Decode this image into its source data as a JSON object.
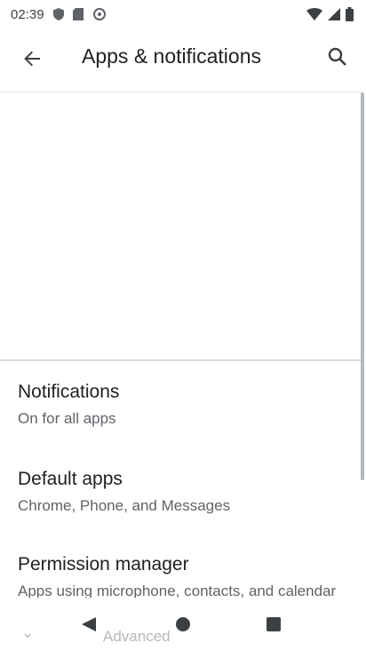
{
  "status_bar": {
    "time": "02:39"
  },
  "app_bar": {
    "title": "Apps & notifications"
  },
  "list": [
    {
      "title": "Notifications",
      "subtitle": "On for all apps"
    },
    {
      "title": "Default apps",
      "subtitle": "Chrome, Phone, and Messages"
    },
    {
      "title": "Permission manager",
      "subtitle": "Apps using microphone, contacts, and calendar"
    }
  ],
  "advanced": {
    "label": "Advanced"
  },
  "icons": {
    "back": "arrow-back-icon",
    "search": "search-icon",
    "nav_back": "triangle-back-icon",
    "nav_home": "circle-home-icon",
    "nav_recents": "square-recents-icon"
  },
  "colors": {
    "text_primary": "#202124",
    "text_secondary": "#5f6368",
    "icon": "#3c4043"
  }
}
